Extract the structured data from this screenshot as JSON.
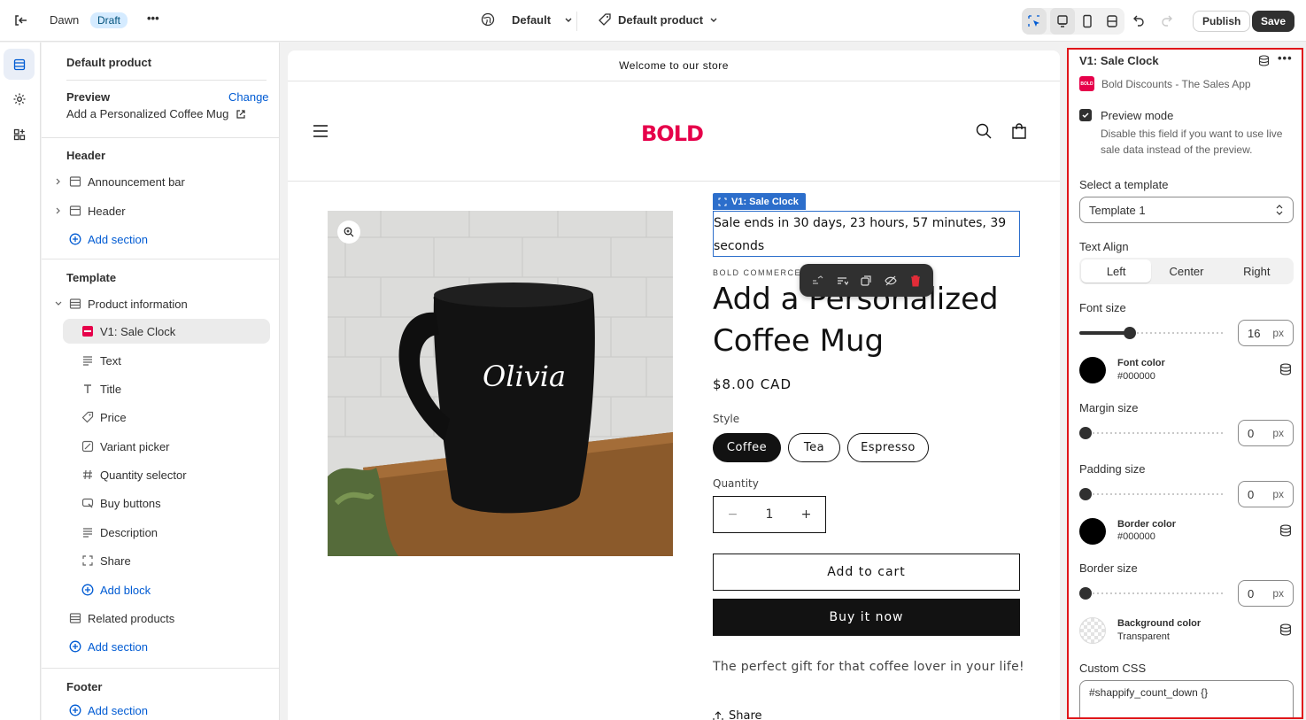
{
  "topbar": {
    "theme_name": "Dawn",
    "status_badge": "Draft",
    "more_label": "•••",
    "market_label": "Default",
    "template_label": "Default product",
    "publish_label": "Publish",
    "save_label": "Save"
  },
  "left_panel": {
    "title": "Default product",
    "preview": {
      "label": "Preview",
      "change_label": "Change",
      "product": "Add a Personalized Coffee Mug"
    },
    "header_group": {
      "title": "Header",
      "items": [
        "Announcement bar",
        "Header"
      ],
      "add_section": "Add section"
    },
    "template_group": {
      "title": "Template",
      "section": "Product information",
      "blocks": [
        "V1: Sale Clock",
        "Text",
        "Title",
        "Price",
        "Variant picker",
        "Quantity selector",
        "Buy buttons",
        "Description",
        "Share"
      ],
      "add_block": "Add block",
      "related": "Related products",
      "add_section": "Add section"
    },
    "footer_group": {
      "title": "Footer",
      "add_section": "Add section"
    }
  },
  "canvas": {
    "announcement": "Welcome to our store",
    "logo": "BOLD",
    "sale_clock_tag": "V1: Sale Clock",
    "sale_clock_text": "Sale ends in 30 days, 23 hours, 57 minutes, 39 seconds",
    "vendor": "BOLD COMMERCE DE",
    "product_title": "Add a Personalized Coffee Mug",
    "mug_text": "Olivia",
    "price": "$8.00 CAD",
    "style_label": "Style",
    "style_options": [
      "Coffee",
      "Tea",
      "Espresso"
    ],
    "style_selected": "Coffee",
    "quantity_label": "Quantity",
    "quantity_value": "1",
    "add_to_cart": "Add to cart",
    "buy_now": "Buy it now",
    "description": "The perfect gift for that coffee lover in your life!",
    "share": "Share"
  },
  "settings": {
    "title": "V1: Sale Clock",
    "app_name": "Bold Discounts - The Sales App",
    "app_logo_text": "BOLD",
    "preview_mode": {
      "label": "Preview mode",
      "checked": true,
      "help": "Disable this field if you want to use live sale data instead of the preview."
    },
    "template": {
      "label": "Select a template",
      "value": "Template 1"
    },
    "text_align": {
      "label": "Text Align",
      "options": [
        "Left",
        "Center",
        "Right"
      ],
      "selected": "Left"
    },
    "font_size": {
      "label": "Font size",
      "value": "16",
      "unit": "px"
    },
    "font_color": {
      "label": "Font color",
      "value": "#000000"
    },
    "margin_size": {
      "label": "Margin size",
      "value": "0",
      "unit": "px"
    },
    "padding_size": {
      "label": "Padding size",
      "value": "0",
      "unit": "px"
    },
    "border_color": {
      "label": "Border color",
      "value": "#000000"
    },
    "border_size": {
      "label": "Border size",
      "value": "0",
      "unit": "px"
    },
    "background_color": {
      "label": "Background color",
      "value": "Transparent"
    },
    "custom_css": {
      "label": "Custom CSS",
      "value": "#shappify_count_down {}"
    }
  },
  "colors": {
    "accent": "#005bd3",
    "selection_blue": "#2c6ecb",
    "brand_red": "#e6004a",
    "highlight_border": "#e0161a"
  },
  "icons": [
    "exit-icon",
    "globe-icon",
    "tag-icon",
    "chevron-down-icon",
    "select-icon",
    "desktop-icon",
    "mobile-icon",
    "fullwidth-icon",
    "undo-icon",
    "redo-icon",
    "sections-icon",
    "settings-icon",
    "apps-icon",
    "external-link-icon",
    "search-icon",
    "cart-icon",
    "menu-icon",
    "zoom-icon",
    "database-icon",
    "more-icon"
  ]
}
